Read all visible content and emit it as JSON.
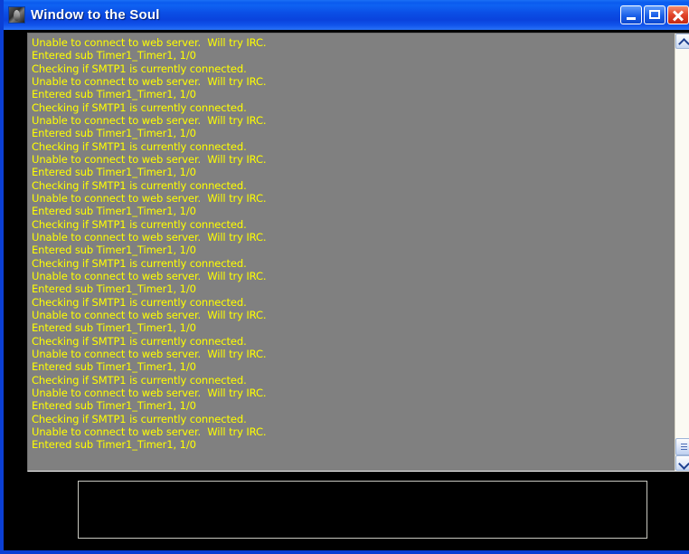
{
  "window": {
    "title": "Window to the Soul",
    "icon": "portrait-thumbnail-icon",
    "frame_color": "#0b3fd4",
    "titlebar_color": "#0b4fe6",
    "controls": {
      "minimize_label": "Minimize",
      "maximize_label": "Maximize",
      "close_label": "Close"
    }
  },
  "log": {
    "background_color": "#808080",
    "text_color": "#ffff00",
    "messages": [
      "Unable to connect to web server.  Will try IRC.",
      "Entered sub Timer1_Timer1, 1/0",
      "Checking if SMTP1 is currently connected.",
      "Unable to connect to web server.  Will try IRC.",
      "Entered sub Timer1_Timer1, 1/0",
      "Checking if SMTP1 is currently connected.",
      "Unable to connect to web server.  Will try IRC.",
      "Entered sub Timer1_Timer1, 1/0",
      "Checking if SMTP1 is currently connected.",
      "Unable to connect to web server.  Will try IRC.",
      "Entered sub Timer1_Timer1, 1/0",
      "Checking if SMTP1 is currently connected.",
      "Unable to connect to web server.  Will try IRC.",
      "Entered sub Timer1_Timer1, 1/0",
      "Checking if SMTP1 is currently connected.",
      "Unable to connect to web server.  Will try IRC.",
      "Entered sub Timer1_Timer1, 1/0",
      "Checking if SMTP1 is currently connected.",
      "Unable to connect to web server.  Will try IRC.",
      "Entered sub Timer1_Timer1, 1/0",
      "Checking if SMTP1 is currently connected.",
      "Unable to connect to web server.  Will try IRC.",
      "Entered sub Timer1_Timer1, 1/0",
      "Checking if SMTP1 is currently connected.",
      "Unable to connect to web server.  Will try IRC.",
      "Entered sub Timer1_Timer1, 1/0",
      "Checking if SMTP1 is currently connected.",
      "Unable to connect to web server.  Will try IRC.",
      "Entered sub Timer1_Timer1, 1/0",
      "Checking if SMTP1 is currently connected.",
      "Unable to connect to web server.  Will try IRC.",
      "Entered sub Timer1_Timer1, 1/0"
    ]
  },
  "scrollbar": {
    "up_icon": "chevron-up-icon",
    "down_icon": "chevron-down-icon",
    "thumb_position": "bottom"
  },
  "input_panel": {
    "value": "",
    "placeholder": ""
  }
}
